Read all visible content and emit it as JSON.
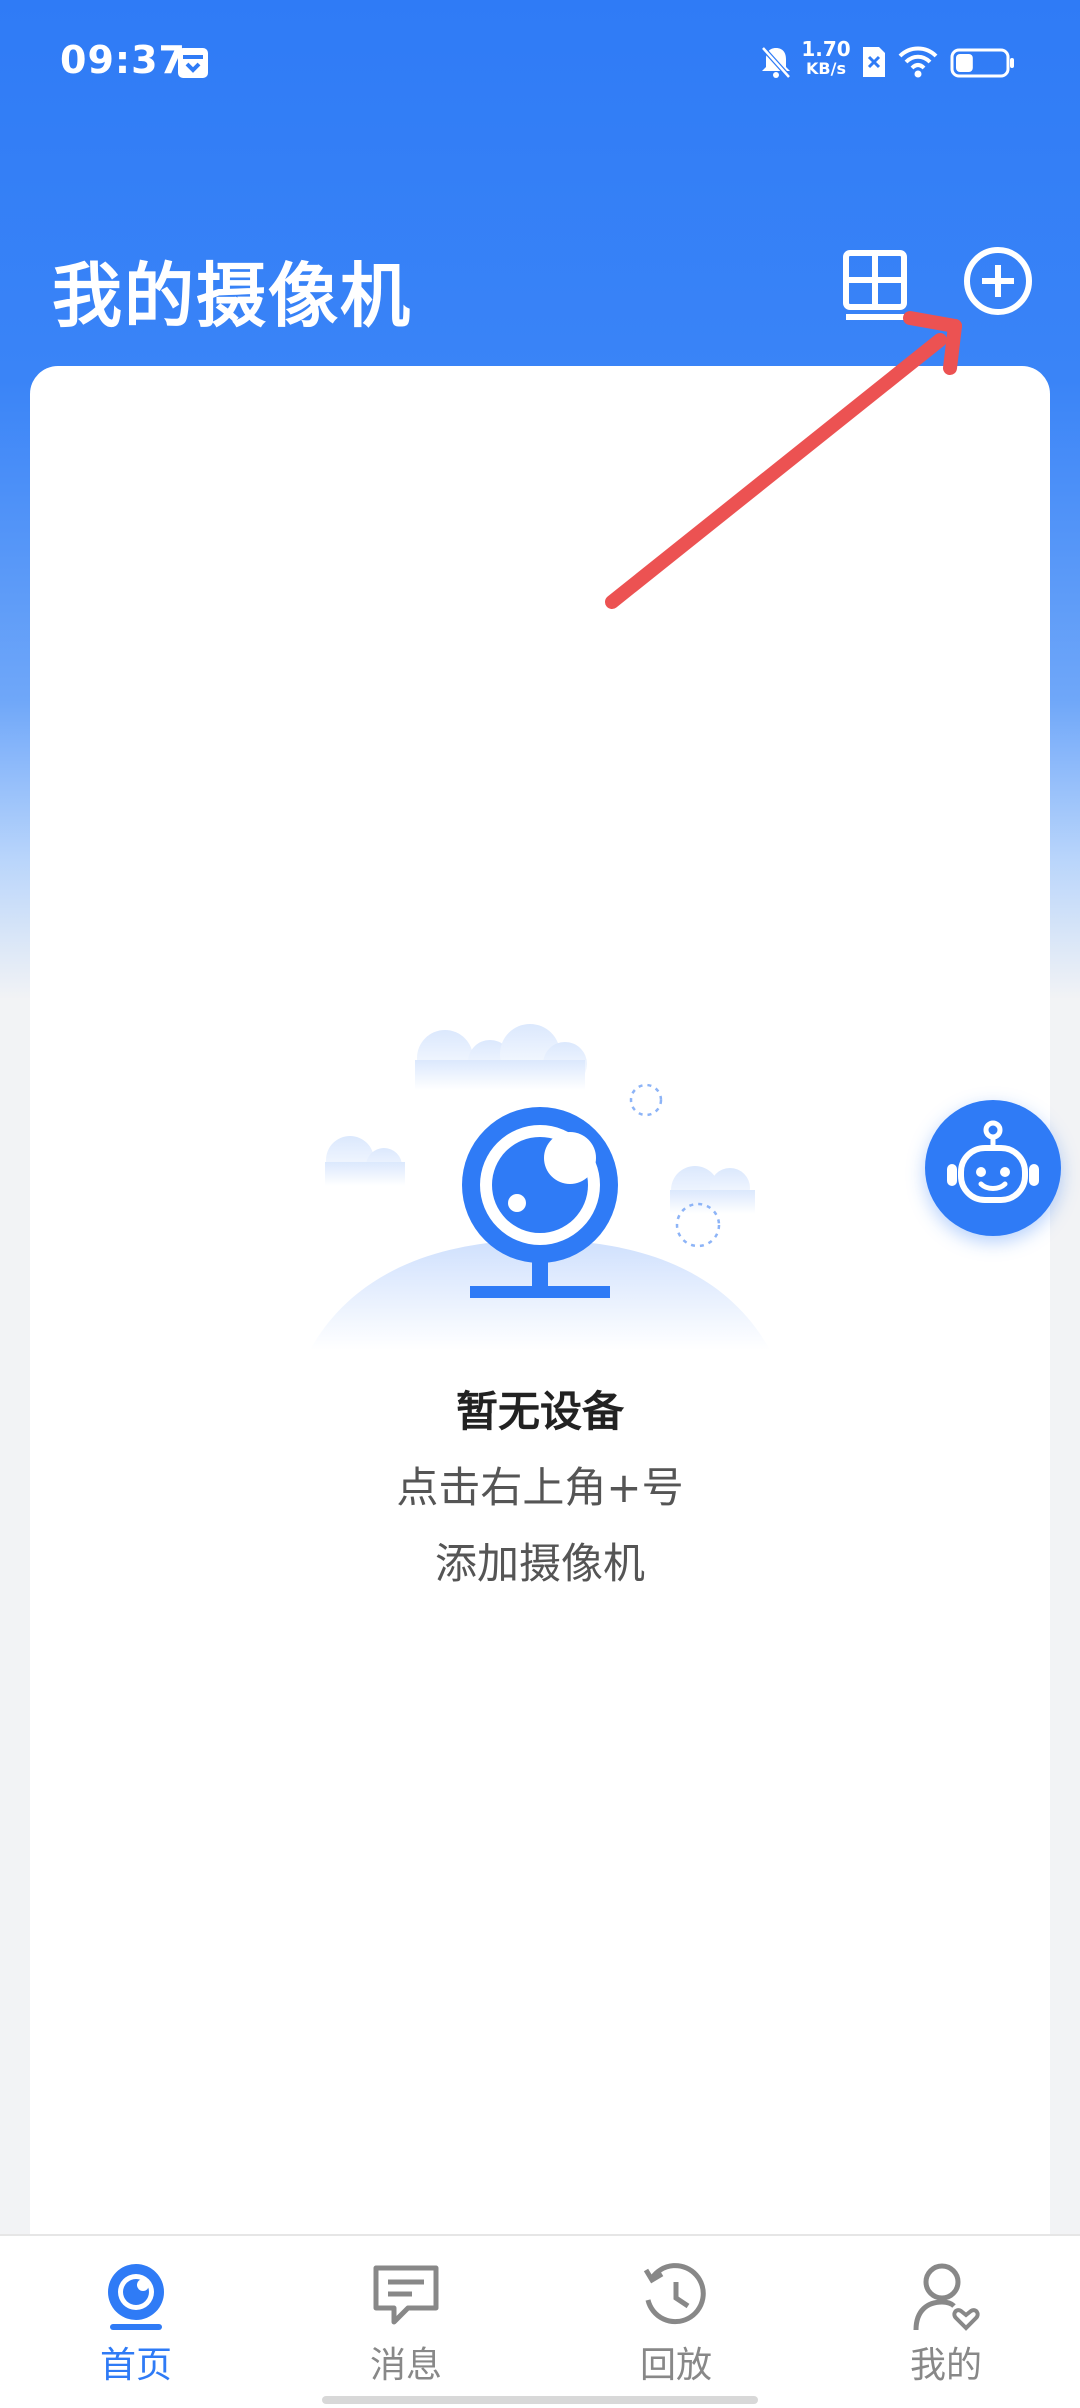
{
  "status_bar": {
    "time": "09:37",
    "network_speed_value": "1.70",
    "network_speed_unit": "KB/s",
    "battery_level": 0.35
  },
  "header": {
    "title": "我的摄像机",
    "grid_icon": "grid-view-icon",
    "add_icon": "add-circle-icon"
  },
  "empty_state": {
    "title": "暂无设备",
    "line1": "点击右上角+号",
    "line2": "添加摄像机"
  },
  "assistant": {
    "icon": "robot-assistant-icon"
  },
  "nav": {
    "items": [
      {
        "label": "首页",
        "icon": "camera-home-icon",
        "active": true
      },
      {
        "label": "消息",
        "icon": "message-icon",
        "active": false
      },
      {
        "label": "回放",
        "icon": "history-icon",
        "active": false
      },
      {
        "label": "我的",
        "icon": "profile-icon",
        "active": false
      }
    ]
  },
  "colors": {
    "primary": "#2f7bf6",
    "arrow": "#ec5252",
    "inactive": "#888888"
  }
}
